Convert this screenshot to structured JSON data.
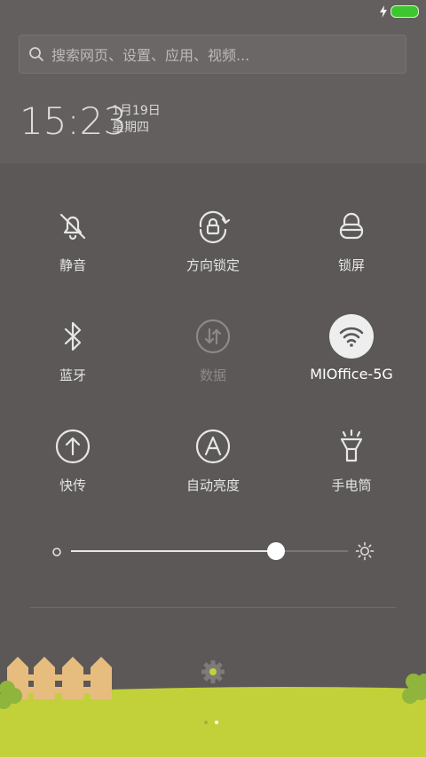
{
  "search": {
    "placeholder": "搜索网页、设置、应用、视频..."
  },
  "clock": {
    "time": "15:23",
    "date": "1月19日",
    "weekday": "星期四"
  },
  "toggles": [
    {
      "label": "静音",
      "icon": "bell-mute-icon",
      "state": "off"
    },
    {
      "label": "方向锁定",
      "icon": "rotation-lock-icon",
      "state": "off"
    },
    {
      "label": "锁屏",
      "icon": "lock-icon",
      "state": "off"
    },
    {
      "label": "蓝牙",
      "icon": "bluetooth-icon",
      "state": "off"
    },
    {
      "label": "数据",
      "icon": "mobile-data-icon",
      "state": "disabled"
    },
    {
      "label": "MIOffice-5G",
      "icon": "wifi-icon",
      "state": "on"
    },
    {
      "label": "快传",
      "icon": "share-upload-icon",
      "state": "off"
    },
    {
      "label": "自动亮度",
      "icon": "auto-brightness-icon",
      "state": "off"
    },
    {
      "label": "手电筒",
      "icon": "flashlight-icon",
      "state": "off"
    }
  ],
  "brightness": {
    "level": 0.74
  },
  "pager": {
    "pages": 2,
    "current": 2
  },
  "colors": {
    "battery": "#3dc62f",
    "grass": "#c2d13a",
    "fence": "#e7bd7f",
    "bush": "#8fb53d"
  }
}
